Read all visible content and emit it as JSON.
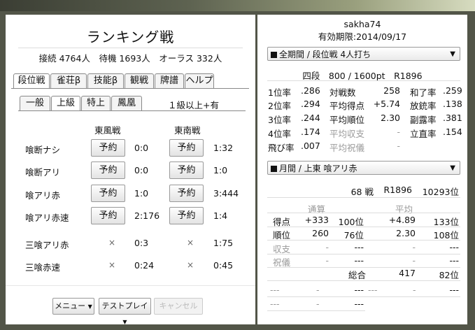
{
  "left": {
    "title": "ランキング戦",
    "stats": "接続 4764人　待機 1693人　オーラス 332人",
    "main_tabs": [
      "段位戦",
      "雀荘β",
      "技能β",
      "観戦",
      "牌譜",
      "ヘルプ"
    ],
    "sub_tabs": [
      "一般",
      "上級",
      "特上",
      "鳳凰"
    ],
    "rank_req": "１級以上+有",
    "col_east": "東風戦",
    "col_south": "東南戦",
    "reserve_label": "予約",
    "x_mark": "×",
    "rows": [
      {
        "name": "喰断ナシ",
        "east": "0:0",
        "south": "1:32"
      },
      {
        "name": "喰断アリ",
        "east": "0:0",
        "south": "1:0"
      },
      {
        "name": "喰アリ赤",
        "east": "1:0",
        "south": "3:444"
      },
      {
        "name": "喰アリ赤速",
        "east": "2:176",
        "south": "1:4"
      },
      {
        "name": "三喰アリ赤",
        "east": "0:3",
        "south": "1:75"
      },
      {
        "name": "三喰赤速",
        "east": "0:24",
        "south": "0:45"
      }
    ],
    "menu_label": "メニュー",
    "testplay_label": "テストプレイ",
    "cancel_label": "キャンセル"
  },
  "right": {
    "username": "sakha74",
    "expiry": "有効期限:2014/09/17",
    "select1": "全期間 / 段位戦 4人打ち",
    "rank_line": "四段　800 / 1600pt　R1896",
    "stats": [
      [
        "1位率",
        ".286",
        "対戦数",
        "258",
        "和了率",
        ".259"
      ],
      [
        "2位率",
        ".294",
        "平均得点",
        "+5.74",
        "放銃率",
        ".138"
      ],
      [
        "3位率",
        ".244",
        "平均順位",
        "2.30",
        "副露率",
        ".381"
      ],
      [
        "4位率",
        ".174",
        "平均収支",
        "-",
        "立直率",
        ".154"
      ],
      [
        "飛び率",
        ".007",
        "平均祝儀",
        "-",
        "",
        ""
      ]
    ],
    "select2": "月間 / 上東 喰アリ赤",
    "games": "68 戦",
    "rating": "R1896",
    "rank_pos": "10293位",
    "hdr_total": "通算",
    "hdr_avg": "平均",
    "table": [
      [
        "得点",
        "+333",
        "100位",
        "+4.89",
        "133位"
      ],
      [
        "順位",
        "260",
        "76位",
        "2.30",
        "108位"
      ],
      [
        "収支",
        "-",
        "---",
        "-",
        "---"
      ],
      [
        "祝儀",
        "-",
        "---",
        "-",
        "---"
      ]
    ],
    "overall_label": "総合",
    "overall_val": "417",
    "overall_rank": "82位",
    "foot": [
      "---",
      "-",
      "---",
      "---",
      "-",
      "---"
    ],
    "foot2": [
      "---",
      "-",
      "---"
    ]
  }
}
